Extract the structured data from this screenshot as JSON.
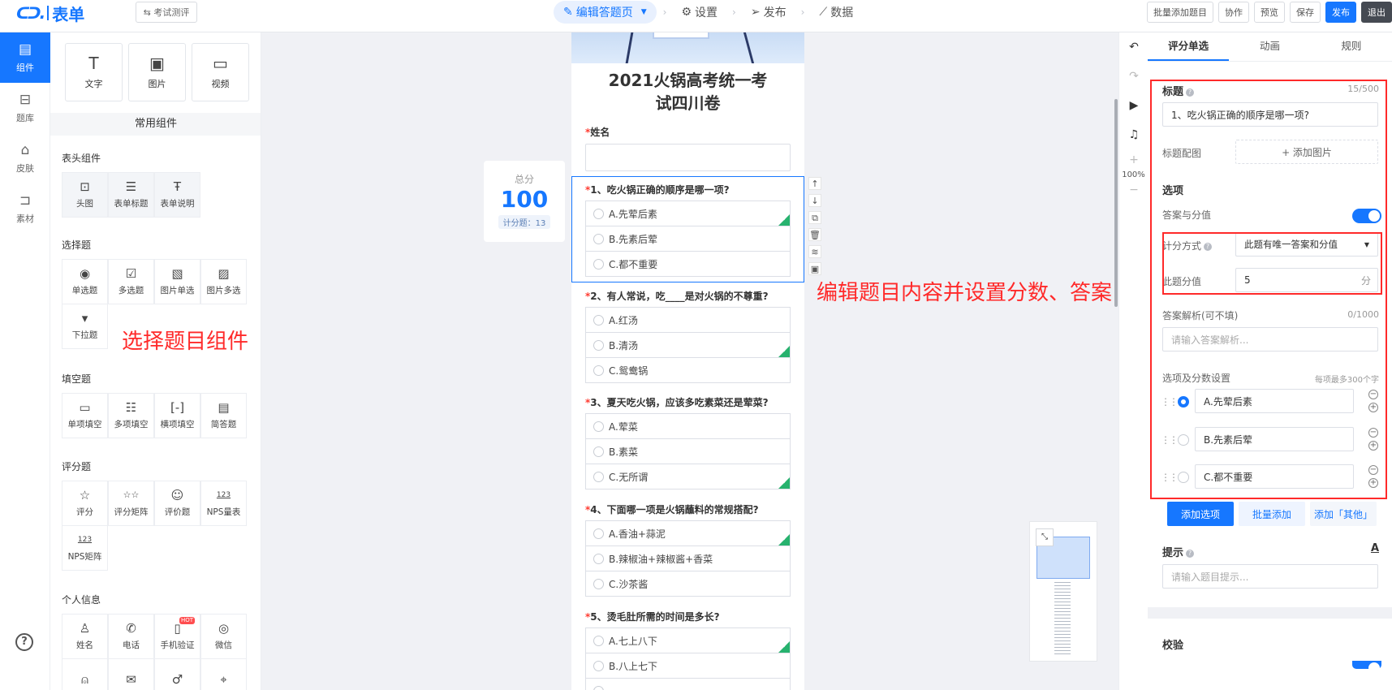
{
  "header": {
    "logo_text": "表单",
    "exam_button": "⇆ 考试测评",
    "steps": [
      {
        "label": "编辑答题页",
        "icon": "edit-icon"
      },
      {
        "label": "设置",
        "icon": "gear-icon"
      },
      {
        "label": "发布",
        "icon": "send-icon"
      },
      {
        "label": "数据",
        "icon": "chart-icon"
      }
    ],
    "actions": {
      "bulk_add": "批量添加题目",
      "collab": "协作",
      "preview": "预览",
      "save": "保存",
      "publish": "发布",
      "exit": "退出"
    }
  },
  "rail": {
    "items": [
      {
        "label": "组件",
        "icon": "components-icon"
      },
      {
        "label": "题库",
        "icon": "library-icon"
      },
      {
        "label": "皮肤",
        "icon": "shirt-icon"
      },
      {
        "label": "素材",
        "icon": "material-icon"
      }
    ]
  },
  "components": {
    "basic": [
      {
        "label": "文字",
        "icon": "text-icon"
      },
      {
        "label": "图片",
        "icon": "image-icon"
      },
      {
        "label": "视频",
        "icon": "video-icon"
      }
    ],
    "common_title": "常用组件",
    "groups": {
      "header": {
        "title": "表头组件",
        "items": [
          "头图",
          "表单标题",
          "表单说明"
        ]
      },
      "choice": {
        "title": "选择题",
        "items": [
          "单选题",
          "多选题",
          "图片单选",
          "图片多选",
          "下拉题"
        ]
      },
      "fill": {
        "title": "填空题",
        "items": [
          "单项填空",
          "多项填空",
          "横项填空",
          "简答题"
        ]
      },
      "rating": {
        "title": "评分题",
        "items": [
          "评分",
          "评分矩阵",
          "评价题",
          "NPS量表",
          "NPS矩阵"
        ]
      },
      "personal": {
        "title": "个人信息",
        "items": [
          "姓名",
          "电话",
          "手机验证",
          "微信"
        ],
        "hot": "HOT"
      }
    },
    "annotation": "选择题目组件"
  },
  "canvas": {
    "score": {
      "label": "总分",
      "value": "100",
      "count": "计分题：13"
    },
    "form_title": "2021火锅高考统一考试四川卷",
    "name_label": "姓名",
    "questions": [
      {
        "title": "1、吃火锅正确的顺序是哪一项?",
        "options": [
          "A.先荤后素",
          "B.先素后荤",
          "C.都不重要"
        ]
      },
      {
        "title": "2、有人常说，吃____是对火锅的不尊重?",
        "options": [
          "A.红汤",
          "B.清汤",
          "C.鸳鸯锅"
        ]
      },
      {
        "title": "3、夏天吃火锅，应该多吃素菜还是荤菜?",
        "options": [
          "A.荤菜",
          "B.素菜",
          "C.无所谓"
        ]
      },
      {
        "title": "4、下面哪一项是火锅蘸料的常规搭配?",
        "options": [
          "A.香油+蒜泥",
          "B.辣椒油+辣椒酱+香菜",
          "C.沙茶酱"
        ]
      },
      {
        "title": "5、烫毛肚所需的时间是多长?",
        "options": [
          "A.七上八下",
          "B.八上七下"
        ]
      }
    ],
    "annotation": "编辑题目内容并设置分数、答案"
  },
  "right_tools": {
    "zoom": "100%"
  },
  "settings": {
    "tabs": [
      "评分单选",
      "动画",
      "规则"
    ],
    "title_label": "标题",
    "title_count": "15/500",
    "title_value": "1、吃火锅正确的顺序是哪一项?",
    "title_image_label": "标题配图",
    "add_image": "+ 添加图片",
    "options_label": "选项",
    "answer_score_label": "答案与分值",
    "score_mode_label": "计分方式",
    "score_mode_value": "此题有唯一答案和分值",
    "score_value_label": "此题分值",
    "score_value": "5",
    "score_unit": "分",
    "analysis_label": "答案解析(可不填)",
    "analysis_count": "0/1000",
    "analysis_placeholder": "请输入答案解析...",
    "option_score_label": "选项及分数设置",
    "option_score_hint": "每项最多300个字",
    "options": [
      "A.先荤后素",
      "B.先素后荤",
      "C.都不重要"
    ],
    "add_option": "添加选项",
    "bulk_add": "批量添加",
    "add_other": "添加「其他」",
    "hint_label": "提示",
    "hint_placeholder": "请输入题目提示...",
    "validate_label": "校验"
  }
}
